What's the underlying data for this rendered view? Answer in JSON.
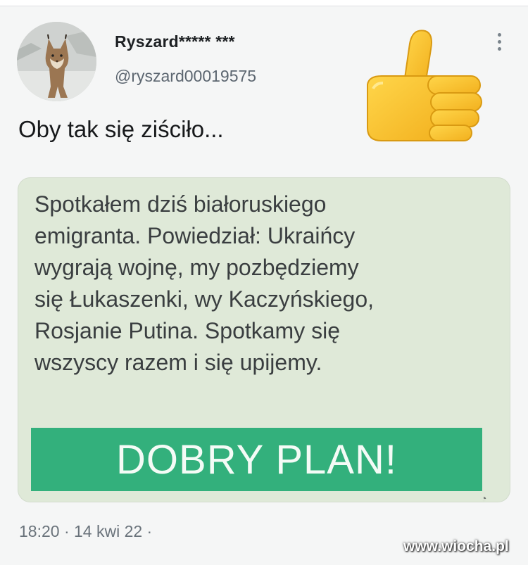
{
  "tweet": {
    "author_name": "Ryszard***** ***",
    "author_handle": "@ryszard00019575",
    "text": "Oby tak się ziściło...",
    "emoji": "thumbs-up",
    "timestamp": "18:20 · 14 kwi 22 ·"
  },
  "quoted_card": {
    "lines": [
      "Spotkałem dziś białoruskiego",
      "emigranta. Powiedział: Ukraińcy",
      "wygrają wojnę, my pozbędziemy",
      "się Łukaszenki, wy Kaczyńskiego,",
      "Rosjanie Putina. Spotkamy się",
      "wszyscy razem i się upijemy."
    ],
    "banner": "DOBRY PLAN!",
    "banner_color": "#33b07c"
  },
  "watermark": "www.wiocha.pl"
}
